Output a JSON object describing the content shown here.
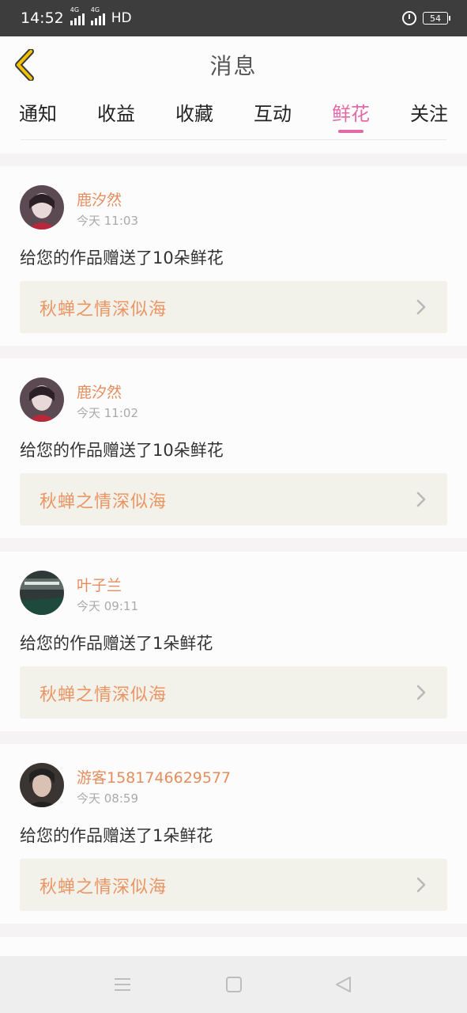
{
  "status_bar": {
    "time": "14:52",
    "network_1": "4G",
    "network_2": "4G",
    "hd": "HD",
    "battery": "54"
  },
  "header": {
    "title": "消息"
  },
  "tabs": [
    {
      "label": "通知"
    },
    {
      "label": "收益"
    },
    {
      "label": "收藏"
    },
    {
      "label": "互动"
    },
    {
      "label": "鲜花",
      "active": true
    },
    {
      "label": "关注"
    }
  ],
  "messages": [
    {
      "username": "鹿汐然",
      "time": "今天 11:03",
      "text": "给您的作品赠送了10朵鲜花",
      "work_title": "秋蝉之情深似海",
      "avatar_colors": [
        "#5b4a52",
        "#e8d9d8",
        "#b8283a"
      ]
    },
    {
      "username": "鹿汐然",
      "time": "今天 11:02",
      "text": "给您的作品赠送了10朵鲜花",
      "work_title": "秋蝉之情深似海",
      "avatar_colors": [
        "#5b4a52",
        "#e8d9d8",
        "#b8283a"
      ]
    },
    {
      "username": "叶子兰",
      "time": "今天 09:11",
      "text": "给您的作品赠送了1朵鲜花",
      "work_title": "秋蝉之情深似海",
      "avatar_colors": [
        "#2f3a38",
        "#5f6b66",
        "#1e4a3e"
      ]
    },
    {
      "username": "游客1581746629577",
      "time": "今天 08:59",
      "text": "给您的作品赠送了1朵鲜花",
      "work_title": "秋蝉之情深似海",
      "avatar_colors": [
        "#3a3432",
        "#d9c2b4",
        "#222"
      ]
    }
  ],
  "colors": {
    "accent_pink": "#e36aa6",
    "username_orange": "#e58d5d",
    "work_title_orange": "#ea9563",
    "back_arrow_yellow": "#f2c200"
  },
  "icons": {
    "back": "back-arrow-icon",
    "chevron": "chevron-right-icon",
    "nav_menu": "menu-icon",
    "nav_home": "home-square-icon",
    "nav_back": "back-triangle-icon"
  }
}
